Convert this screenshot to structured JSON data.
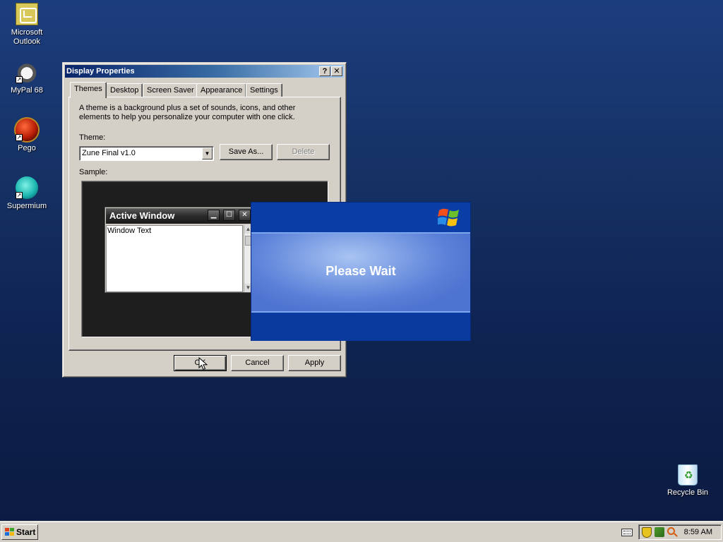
{
  "desktop": {
    "icons": [
      {
        "label": "Microsoft Outlook",
        "icon": "outlook-icon"
      },
      {
        "label": "MyPal 68",
        "icon": "mypal-icon"
      },
      {
        "label": "Pego",
        "icon": "pego-icon"
      },
      {
        "label": "Supermium",
        "icon": "supermium-icon"
      }
    ],
    "recycle_bin": {
      "label": "Recycle Bin",
      "icon": "recycle-bin-icon"
    }
  },
  "dialog": {
    "title": "Display Properties",
    "help_btn": "?",
    "close_btn": "✕",
    "tabs": [
      "Themes",
      "Desktop",
      "Screen Saver",
      "Appearance",
      "Settings"
    ],
    "active_tab": "Themes",
    "description": "A theme is a background plus a set of sounds, icons, and other elements to help you personalize your computer with one click.",
    "theme_label": "Theme:",
    "theme_value": "Zune Final v1.0",
    "save_as": "Save As...",
    "delete": "Delete",
    "sample_label": "Sample:",
    "preview": {
      "title": "Active Window",
      "body_text": "Window Text"
    },
    "ok": "OK",
    "cancel": "Cancel",
    "apply": "Apply"
  },
  "please_wait": {
    "text": "Please Wait"
  },
  "taskbar": {
    "start": "Start",
    "clock": "8:59 AM"
  },
  "colors": {
    "desktop_top": "#1c3d7e",
    "desktop_bottom": "#0b1a3f",
    "title_active": "#0a246a",
    "dialog_face": "#d4d0c8",
    "wait_panel": "#0a3a9e"
  }
}
